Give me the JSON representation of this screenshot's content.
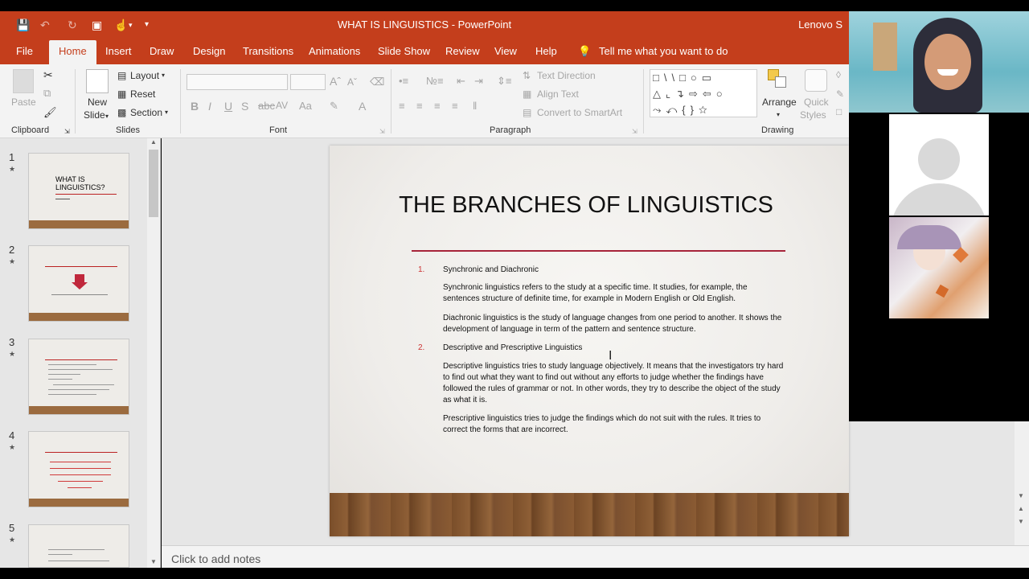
{
  "window": {
    "title": "WHAT IS LINGUISTICS  -  PowerPoint",
    "user": "Lenovo S"
  },
  "tabs": [
    "File",
    "Home",
    "Insert",
    "Draw",
    "Design",
    "Transitions",
    "Animations",
    "Slide Show",
    "Review",
    "View",
    "Help"
  ],
  "active_tab": "Home",
  "tell_me": "Tell me what you want to do",
  "ribbon": {
    "clipboard": {
      "label": "Clipboard",
      "paste": "Paste"
    },
    "slides": {
      "label": "Slides",
      "new_slide_1": "New",
      "new_slide_2": "Slide",
      "layout": "Layout",
      "reset": "Reset",
      "section": "Section"
    },
    "font": {
      "label": "Font"
    },
    "paragraph": {
      "label": "Paragraph",
      "text_direction": "Text Direction",
      "align_text": "Align Text",
      "convert_smartart": "Convert to SmartArt"
    },
    "drawing": {
      "label": "Drawing",
      "arrange": "Arrange",
      "quick_styles_1": "Quick",
      "quick_styles_2": "Styles"
    }
  },
  "thumbnails": [
    {
      "number": "1",
      "title": "WHAT IS LINGUISTICS?"
    },
    {
      "number": "2"
    },
    {
      "number": "3"
    },
    {
      "number": "4"
    },
    {
      "number": "5"
    }
  ],
  "slide": {
    "title": "THE BRANCHES OF LINGUISTICS",
    "items": [
      {
        "number": "1.",
        "heading": "Synchronic and Diachronic",
        "paragraphs": [
          "Synchronic linguistics refers to the study at a specific time. It studies, for example, the sentences structure of definite time, for example in Modern English or Old English.",
          "Diachronic linguistics is the study of language changes from one period to another. It shows the development of language in term of the pattern and sentence structure."
        ]
      },
      {
        "number": "2.",
        "heading": "Descriptive and Prescriptive Linguistics",
        "paragraphs": [
          "Descriptive linguistics tries to study language objectively. It means that the investigators try hard to find out what they want to find out without any efforts to judge whether the findings have followed the rules of grammar or not. In other words, they try to describe the object of the study as what it is.",
          "Prescriptive linguistics tries to judge the findings which do not suit with the rules. It tries to correct the forms that are incorrect."
        ]
      }
    ]
  },
  "notes_placeholder": "Click to add notes",
  "colors": {
    "accent": "#c43e1c",
    "slide_rule": "#a7243a"
  }
}
